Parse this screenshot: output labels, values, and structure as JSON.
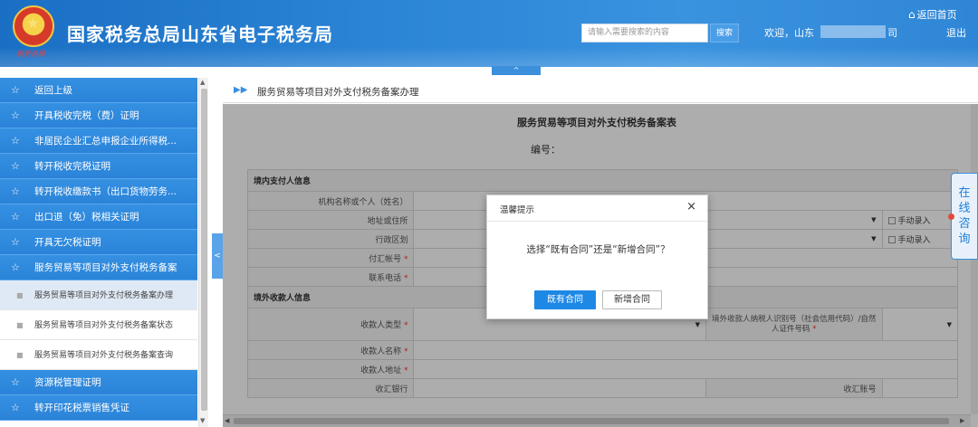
{
  "header": {
    "emblem_text": "税务总局",
    "site_title": "国家税务总局山东省电子税务局",
    "search_placeholder": "请输入需要搜索的内容",
    "search_button": "搜索",
    "welcome_prefix": "欢迎，山东",
    "welcome_suffix": "司",
    "home_link": "返回首页",
    "logout": "退出",
    "collapse_toggle": "^"
  },
  "sidebar": {
    "items": [
      {
        "label": "返回上级"
      },
      {
        "label": "开具税收完税（费）证明"
      },
      {
        "label": "非居民企业汇总申报企业所得税..."
      },
      {
        "label": "转开税收完税证明"
      },
      {
        "label": "转开税收缴款书（出口货物劳务..."
      },
      {
        "label": "出口退（免）税相关证明"
      },
      {
        "label": "开具无欠税证明"
      },
      {
        "label": "服务贸易等项目对外支付税务备案"
      }
    ],
    "sub_items": [
      {
        "label": "服务贸易等项目对外支付税务备案办理"
      },
      {
        "label": "服务贸易等项目对外支付税务备案状态"
      },
      {
        "label": "服务贸易等项目对外支付税务备案查询"
      }
    ],
    "bottom_items": [
      {
        "label": "资源税管理证明"
      },
      {
        "label": "转开印花税票销售凭证"
      }
    ],
    "toggle": "<"
  },
  "breadcrumb": {
    "title": "服务贸易等项目对外支付税务备案办理"
  },
  "form": {
    "title": "服务贸易等项目对外支付税务备案表",
    "number_label": "编号：",
    "section_domestic": "境内支付人信息",
    "f_name": "机构名称或个人（姓名）",
    "f_address": "地址或住所",
    "f_region": "行政区划",
    "f_account": "付汇帐号",
    "f_phone": "联系电话",
    "manual_entry": "手动录入",
    "section_foreign": "境外收款人信息",
    "f_payee_type": "收款人类型",
    "f_payee_taxid": "境外收款人纳税人识别号（社会信用代码）/自然人证件号码",
    "f_payee_name": "收款人名称",
    "f_payee_addr": "收款人地址",
    "f_bank": "收汇银行",
    "f_acct_no": "收汇账号",
    "required_mark": "*"
  },
  "modal": {
    "title": "温馨提示",
    "close": "×",
    "message": "选择“既有合同”还是“新增合同”？",
    "btn_existing": "既有合同",
    "btn_new": "新增合同"
  },
  "consult": {
    "chars": [
      "在",
      "线",
      "咨",
      "询"
    ]
  }
}
